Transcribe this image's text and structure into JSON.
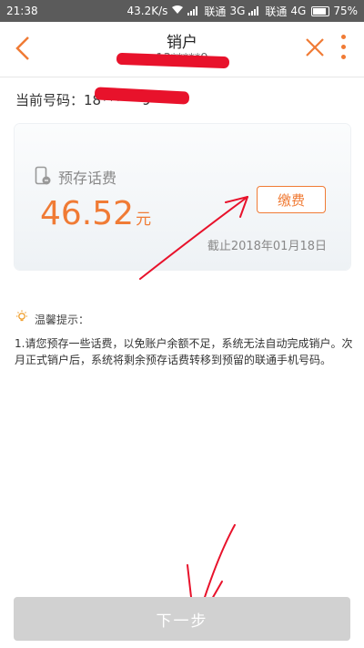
{
  "status_bar": {
    "time": "21:38",
    "speed": "43.2K/s",
    "carrier1": "联通",
    "net1": "3G",
    "carrier2": "联通",
    "net2": "4G",
    "battery": "75%"
  },
  "header": {
    "title": "销户",
    "subtitle": "13*****9"
  },
  "account": {
    "number_label": "当前号码：",
    "number_value": "18******9"
  },
  "card": {
    "label": "预存话费",
    "amount": "46.52",
    "unit": "元",
    "pay_button": "缴费",
    "date": "截止2018年01月18日"
  },
  "tips": {
    "title": "温馨提示：",
    "body": "1.请您预存一些话费，以免账户余额不足，系统无法自动完成销户。次月正式销户后，系统将剩余预存话费转移到预留的联通手机号码。"
  },
  "footer": {
    "next_button": "下一步"
  },
  "colors": {
    "accent": "#f07b35",
    "annotation": "#e8122b",
    "disabled_button": "#d1d1d1"
  }
}
